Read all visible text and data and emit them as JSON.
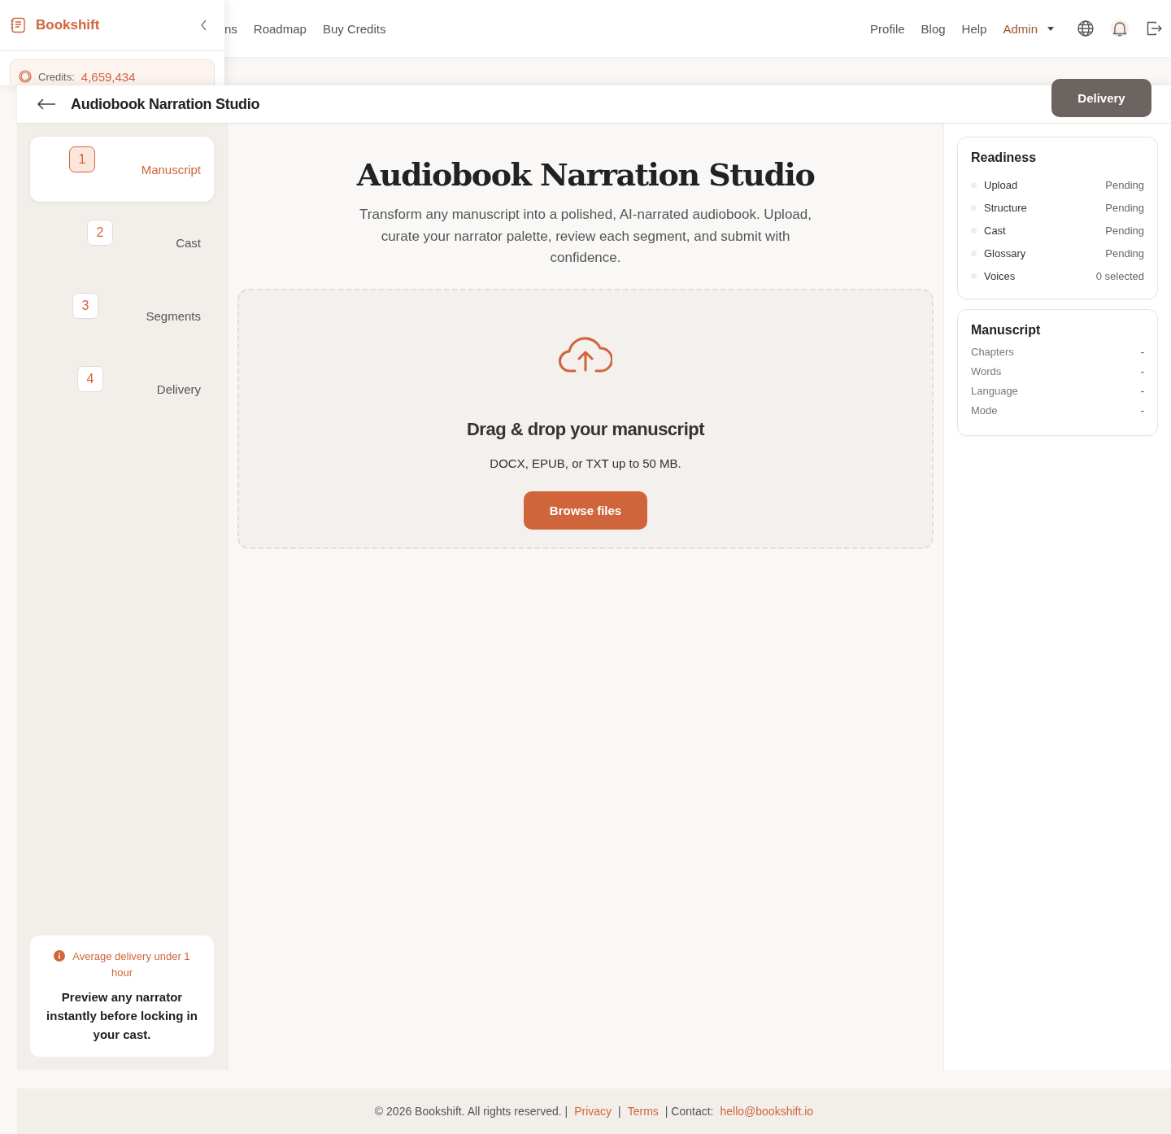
{
  "sidebar": {
    "brand": "Bookshift",
    "credits_label": "Credits:",
    "credits_value": "4,659,434"
  },
  "nav": {
    "items": [
      {
        "label": "ns",
        "kind": "link"
      },
      {
        "label": "Roadmap",
        "kind": "link"
      },
      {
        "label": "Buy Credits",
        "kind": "link"
      }
    ],
    "right_items": [
      {
        "label": "Profile",
        "kind": "link"
      },
      {
        "label": "Blog",
        "kind": "link"
      },
      {
        "label": "Help",
        "kind": "link"
      },
      {
        "label": "Admin",
        "kind": "menu"
      }
    ]
  },
  "header": {
    "title": "Audiobook Narration Studio",
    "action": "Delivery"
  },
  "steps": [
    {
      "number": "1",
      "label": "Manuscript",
      "selected": true
    },
    {
      "number": "2",
      "label": "Cast",
      "selected": false
    },
    {
      "number": "3",
      "label": "Segments",
      "selected": false
    },
    {
      "number": "4",
      "label": "Delivery",
      "selected": false
    }
  ],
  "tip": {
    "note": "Average delivery under 1 hour",
    "text": "Preview any narrator instantly before locking in your cast."
  },
  "hero": {
    "title": "Audiobook Narration Studio",
    "subtitle": "Transform any manuscript into a polished, AI-narrated audiobook. Upload, curate your narrator palette, review each segment, and submit with confidence."
  },
  "dropzone": {
    "title": "Drag & drop your manuscript",
    "hint": "DOCX, EPUB, or TXT up to 50 MB.",
    "button": "Browse files"
  },
  "readiness": {
    "title": "Readiness",
    "items": [
      {
        "label": "Upload",
        "status": "Pending",
        "done": false
      },
      {
        "label": "Structure",
        "status": "Pending",
        "done": false
      },
      {
        "label": "Cast",
        "status": "Pending",
        "done": false
      },
      {
        "label": "Glossary",
        "status": "Pending",
        "done": false
      },
      {
        "label": "Voices",
        "status": "0 selected",
        "done": false
      }
    ]
  },
  "manuscript": {
    "title": "Manuscript",
    "rows": [
      {
        "label": "Chapters",
        "value": "-"
      },
      {
        "label": "Words",
        "value": "-"
      },
      {
        "label": "Language",
        "value": "-"
      },
      {
        "label": "Mode",
        "value": "-"
      }
    ]
  },
  "footer": {
    "copyright": "© 2026 Bookshift. All rights reserved. |",
    "privacy": "Privacy",
    "sep": "|",
    "terms": "Terms",
    "contact": "| Contact:",
    "email": "hello@bookshift.io"
  }
}
